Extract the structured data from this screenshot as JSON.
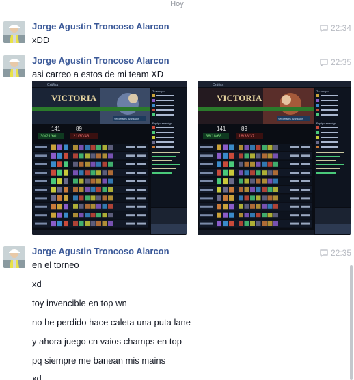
{
  "day_separator": "Hoy",
  "groups": [
    {
      "sender": "Jorge Agustin Troncoso Alarcon",
      "time": "22:34",
      "messages": [
        "xDD"
      ]
    },
    {
      "sender": "Jorge Agustin Troncoso Alarcon",
      "time": "22:35",
      "messages": [
        "asi carreo a estos de mi team XD"
      ],
      "attachments": [
        {
          "banner": "VICTORIA",
          "score_left": "141",
          "score_right": "89",
          "kda_left": "30/21/60",
          "kda_right": "21/30/48",
          "tabs": [
            "Gráfica"
          ],
          "side_header": "Tu equipo",
          "side_header_enemy": "Equipo enemigo",
          "button_label": "Ver detalles avanzados"
        },
        {
          "banner": "VICTORIA",
          "score_left": "141",
          "score_right": "89",
          "kda_left": "38/18/68",
          "kda_right": "18/38/37",
          "tabs": [
            "Gráfica"
          ],
          "side_header": "Tu equipo",
          "side_header_enemy": "Equipo enemigo",
          "button_label": "Ver detalles avanzados"
        }
      ]
    },
    {
      "sender": "Jorge Agustin Troncoso Alarcon",
      "time": "22:35",
      "messages": [
        "en el torneo",
        "xd",
        "toy invencible en top wn",
        "no he perdido hace caleta una puta lane",
        "y ahora juego cn vaios champs en top",
        "pq siempre me banean mis mains",
        "xd"
      ]
    }
  ],
  "colors": {
    "sender": "#3b5998",
    "text": "#141823",
    "meta": "#b7bac2",
    "victory_text": "#e8d6a0",
    "panel_bg": "#0a0d14"
  }
}
